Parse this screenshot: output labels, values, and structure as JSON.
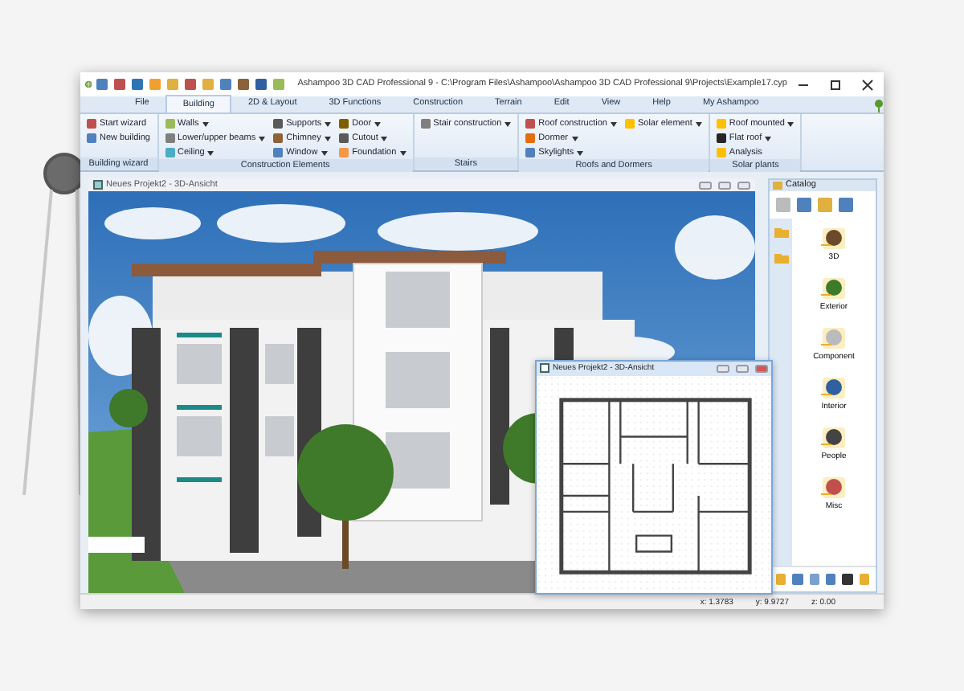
{
  "window": {
    "title": "Ashampoo 3D CAD Professional 9 - C:\\Program Files\\Ashampoo\\Ashampoo 3D CAD Professional 9\\Projects\\Example17.cyp"
  },
  "tabs": [
    {
      "label": "File",
      "selected": false
    },
    {
      "label": "Building",
      "selected": true
    },
    {
      "label": "2D & Layout",
      "selected": false
    },
    {
      "label": "3D Functions",
      "selected": false
    },
    {
      "label": "Construction",
      "selected": false
    },
    {
      "label": "Terrain",
      "selected": false
    },
    {
      "label": "Edit",
      "selected": false
    },
    {
      "label": "View",
      "selected": false
    },
    {
      "label": "Help",
      "selected": false
    },
    {
      "label": "My Ashampoo",
      "selected": false
    }
  ],
  "ribbon_groups": [
    {
      "label": "Building wizard",
      "columns": [
        [
          {
            "label": "Start wizard",
            "dropdown": false,
            "color": "#c0504d"
          },
          {
            "label": "New building",
            "dropdown": false,
            "color": "#4f81bd"
          }
        ]
      ]
    },
    {
      "label": "Construction Elements",
      "columns": [
        [
          {
            "label": "Walls",
            "dropdown": true,
            "color": "#9bbb59"
          },
          {
            "label": "Lower/upper beams",
            "dropdown": true,
            "color": "#7f7f7f"
          },
          {
            "label": "Ceiling",
            "dropdown": true,
            "color": "#4bacc6"
          }
        ],
        [
          {
            "label": "Supports",
            "dropdown": true,
            "color": "#595959"
          },
          {
            "label": "Chimney",
            "dropdown": true,
            "color": "#8c6239"
          },
          {
            "label": "Window",
            "dropdown": true,
            "color": "#4f81bd"
          }
        ],
        [
          {
            "label": "Door",
            "dropdown": true,
            "color": "#7f6000"
          },
          {
            "label": "Cutout",
            "dropdown": true,
            "color": "#595959"
          },
          {
            "label": "Foundation",
            "dropdown": true,
            "color": "#f79646"
          }
        ]
      ]
    },
    {
      "label": "Stairs",
      "columns": [
        [
          {
            "label": "Stair construction",
            "dropdown": true,
            "color": "#7f7f7f"
          }
        ]
      ]
    },
    {
      "label": "Roofs and Dormers",
      "columns": [
        [
          {
            "label": "Roof construction",
            "dropdown": true,
            "color": "#c0504d"
          },
          {
            "label": "Dormer",
            "dropdown": true,
            "color": "#e46c0a"
          },
          {
            "label": "Skylights",
            "dropdown": true,
            "color": "#4f81bd"
          }
        ],
        [
          {
            "label": "Solar element",
            "dropdown": true,
            "color": "#ffc000"
          }
        ]
      ]
    },
    {
      "label": "Solar plants",
      "columns": [
        [
          {
            "label": "Roof mounted",
            "dropdown": true,
            "color": "#ffc000"
          },
          {
            "label": "Flat roof",
            "dropdown": true,
            "color": "#262626"
          },
          {
            "label": "Analysis",
            "dropdown": false,
            "color": "#ffc000"
          }
        ]
      ]
    }
  ],
  "view_3d": {
    "title": "Neues Projekt2 - 3D-Ansicht"
  },
  "plan_window": {
    "title": "Neues Projekt2 - 3D-Ansicht"
  },
  "catalog": {
    "title": "Catalog",
    "items": [
      {
        "label": "3D",
        "selected": false
      },
      {
        "label": "Exterior",
        "selected": false
      },
      {
        "label": "Component",
        "selected": false
      },
      {
        "label": "Interior",
        "selected": false
      },
      {
        "label": "People",
        "selected": false
      },
      {
        "label": "Misc",
        "selected": false
      }
    ]
  },
  "status_bar": [
    "x: 1.3783",
    "y: 9.9727",
    "z: 0.00"
  ]
}
